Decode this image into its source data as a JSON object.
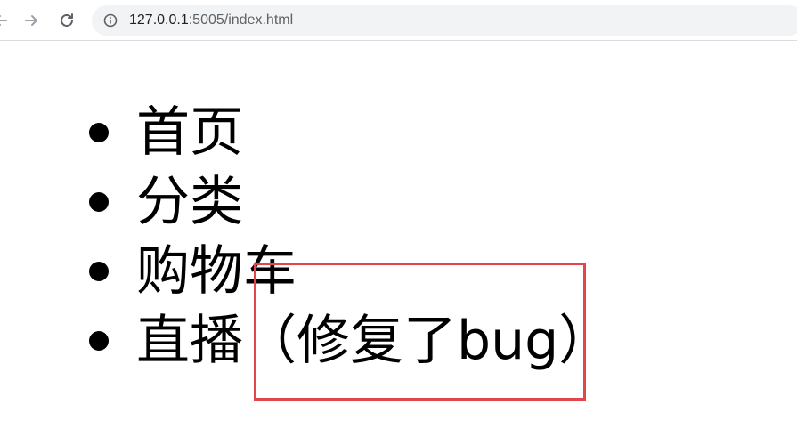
{
  "browser": {
    "url_host": "127.0.0.1",
    "url_rest": ":5005/index.html",
    "icons": {
      "back": "back-arrow-icon",
      "forward": "forward-arrow-icon",
      "reload": "reload-icon",
      "site_info": "info-icon"
    }
  },
  "page": {
    "menu_items": [
      {
        "label": "首页"
      },
      {
        "label": "分类"
      },
      {
        "label": "购物车"
      },
      {
        "label": "直播"
      }
    ],
    "annotation": "（修复了bug）",
    "annotation_color": "#e0474c"
  }
}
